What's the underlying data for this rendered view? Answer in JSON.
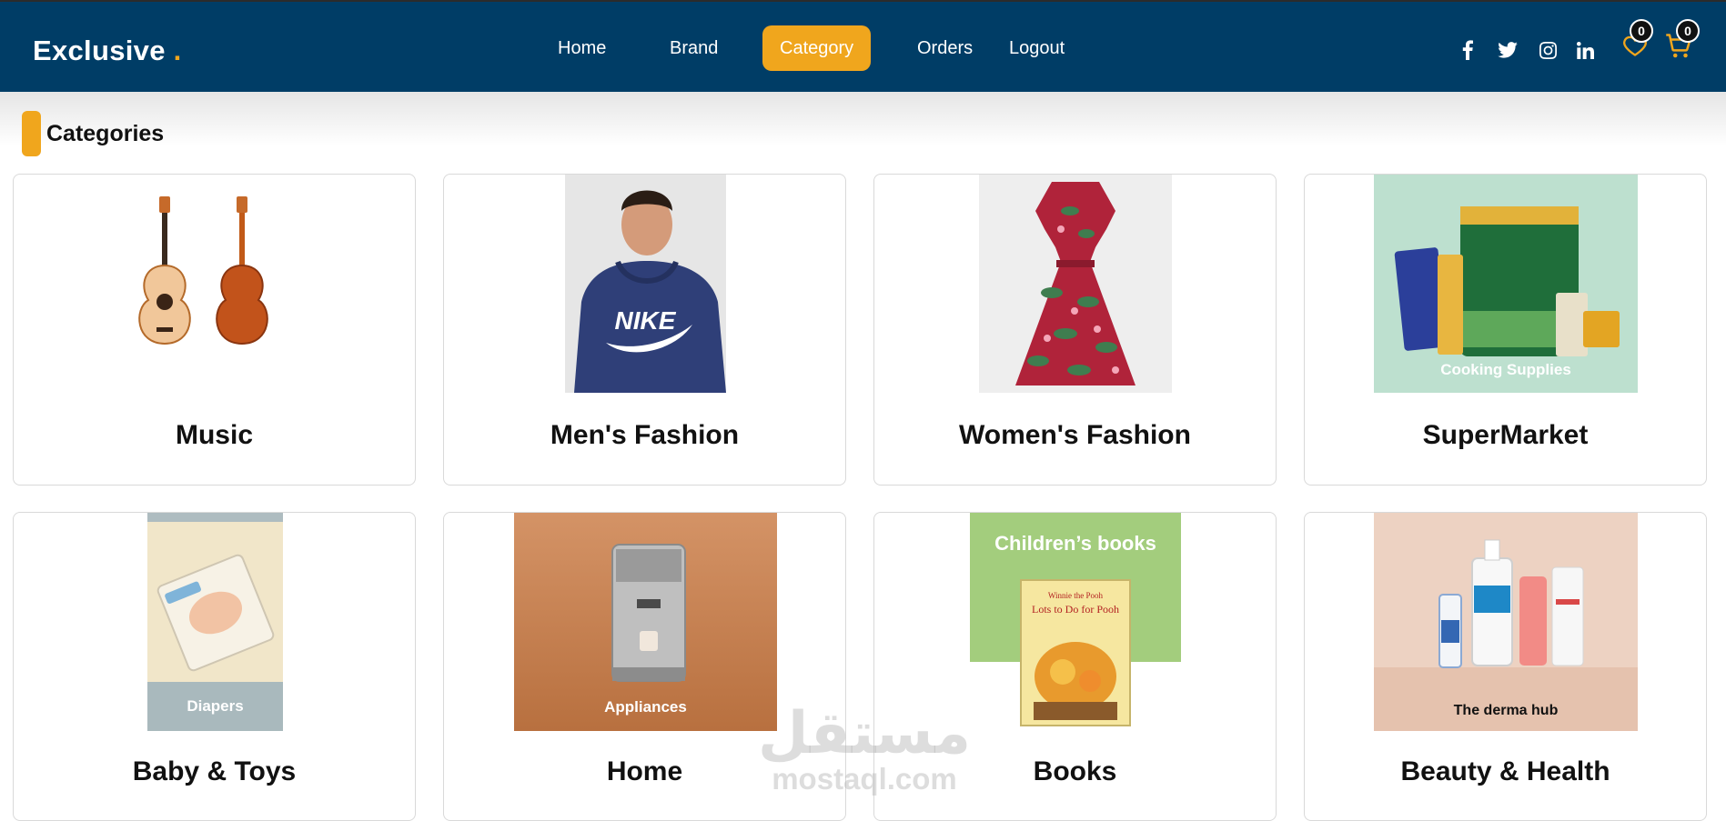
{
  "navbar": {
    "brand": "Exclusive",
    "brand_dot": ".",
    "links": [
      {
        "label": "Home"
      },
      {
        "label": "Brand"
      },
      {
        "label": "Category"
      },
      {
        "label": "Orders"
      },
      {
        "label": "Logout"
      }
    ],
    "active_link": "Category",
    "social_icons": [
      "facebook-icon",
      "twitter-icon",
      "instagram-icon",
      "linkedin-icon"
    ],
    "wishlist_count": "0",
    "cart_count": "0"
  },
  "section": {
    "title": "Categories"
  },
  "categories": [
    {
      "name": "Music",
      "image_label": ""
    },
    {
      "name": "Men's Fashion",
      "image_label": "NIKE"
    },
    {
      "name": "Women's Fashion",
      "image_label": ""
    },
    {
      "name": "SuperMarket",
      "image_label": "Cooking Supplies"
    },
    {
      "name": "Baby & Toys",
      "image_label": "Diapers"
    },
    {
      "name": "Home",
      "image_label": "Appliances"
    },
    {
      "name": "Books",
      "image_label": "Children’s books",
      "book_title": "Lots to Do for Pooh",
      "book_brand": "Winnie the Pooh"
    },
    {
      "name": "Beauty & Health",
      "image_label": "The derma hub"
    }
  ],
  "watermark": {
    "arabic": "مستقل",
    "latin": "mostaql.com"
  },
  "colors": {
    "navbar": "#003d66",
    "accent": "#f0a61d",
    "badge": "#111111"
  }
}
